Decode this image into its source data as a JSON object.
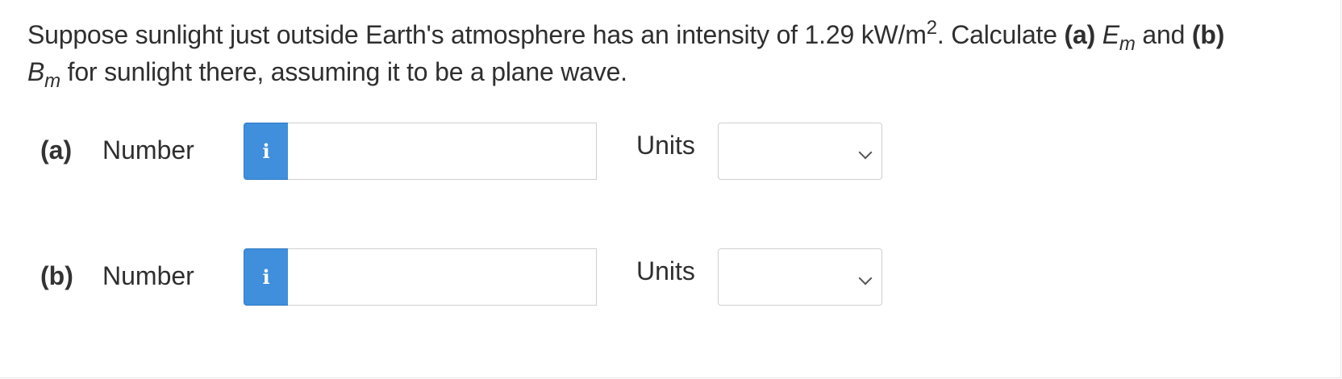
{
  "question": {
    "intro": "Suppose sunlight just outside Earth's atmosphere has an intensity of 1.29 kW/m",
    "sup_2": "2",
    "calc": ". Calculate ",
    "part_a_tag": "(a)",
    "E": "E",
    "m_sub_a": "m",
    "and": " and ",
    "part_b_tag": "(b)",
    "B": "B",
    "m_sub_b": "m",
    "end": " for sunlight there, assuming it to be a plane wave."
  },
  "parts": [
    {
      "label": "(a)",
      "number_label": "Number",
      "info_icon": "i",
      "input_value": "",
      "input_placeholder": "",
      "units_label": "Units",
      "units_selected": ""
    },
    {
      "label": "(b)",
      "number_label": "Number",
      "info_icon": "i",
      "input_value": "",
      "input_placeholder": "",
      "units_label": "Units",
      "units_selected": ""
    }
  ],
  "colors": {
    "info_button": "#3f8fdc",
    "border": "#cfcfcf",
    "text": "#2f2f2f"
  }
}
